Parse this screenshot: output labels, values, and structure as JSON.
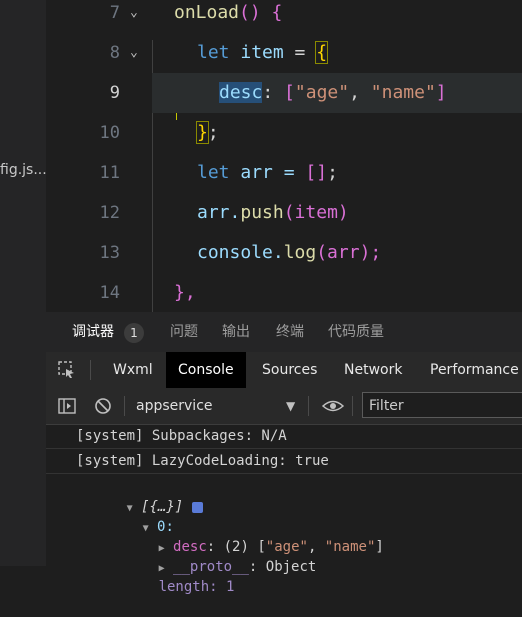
{
  "sidebar": {
    "file_label": "fig.js..."
  },
  "editor": {
    "lines": [
      {
        "num": "7"
      },
      {
        "num": "8"
      },
      {
        "num": "9"
      },
      {
        "num": "10"
      },
      {
        "num": "11"
      },
      {
        "num": "12"
      },
      {
        "num": "13"
      },
      {
        "num": "14"
      }
    ],
    "tokens": {
      "onload_fn": "onLoad",
      "onload_rest": "() {",
      "let1": "let",
      "item": " item ",
      "eq1": "= ",
      "brace_open": "{",
      "desc": "desc",
      "colon": ": ",
      "arr_open": "[",
      "str_age": "\"age\"",
      "comma": ", ",
      "str_name": "\"name\"",
      "arr_close": "]",
      "brace_close": "}",
      "semi": ";",
      "let2": "let",
      "arr_decl": " arr = ",
      "empty_arr": "[]",
      "semi2": ";",
      "arr_obj": "arr.",
      "push": "push",
      "push_args": "(item)",
      "console_obj": "console.",
      "log": "log",
      "log_args": "(arr);",
      "close_fn": "},"
    }
  },
  "devtools": {
    "tabs": [
      {
        "label": "调试器"
      },
      {
        "label": "问题"
      },
      {
        "label": "输出"
      },
      {
        "label": "终端"
      },
      {
        "label": "代码质量"
      }
    ],
    "badge_count": "1",
    "panel_tabs": [
      "Wxml",
      "Console",
      "Sources",
      "Network",
      "Performance"
    ],
    "context_select": "appservice",
    "filter_placeholder": "Filter",
    "console": {
      "msg1": "[system] Subpackages: N/A",
      "msg2": "[system] LazyCodeLoading: true",
      "tree_root": "[{…}]",
      "tree_index": "0:",
      "tree_desc_key": "desc",
      "tree_desc_val": ": (2) [",
      "tree_age": "\"age\"",
      "tree_comma": ", ",
      "tree_name": "\"name\"",
      "tree_close": "]",
      "tree_proto_key": "__proto__",
      "tree_proto_val": ": Object",
      "tree_length": "length: 1"
    }
  },
  "colors": {
    "accent_selection": "#264f78",
    "string": "#ce9178",
    "keyword": "#569cd6",
    "function": "#dcdcaa"
  }
}
